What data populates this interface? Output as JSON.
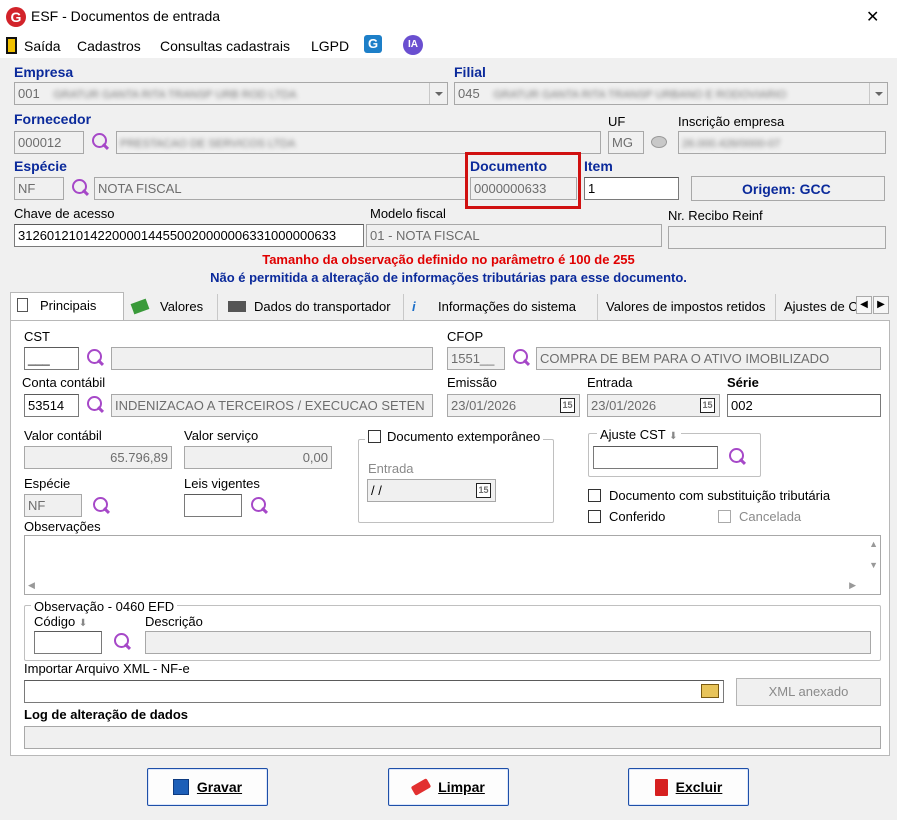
{
  "window": {
    "title": "ESF - Documentos de entrada",
    "close_glyph": "✕"
  },
  "menu": {
    "items": [
      "Saída",
      "Cadastros",
      "Consultas cadastrais",
      "LGPD"
    ],
    "ia_badge": "IA"
  },
  "header": {
    "empresa_label": "Empresa",
    "empresa_code": "001",
    "empresa_name": "GRATUR GANTA RITA TRANSP URB ROD LTDA",
    "filial_label": "Filial",
    "filial_code": "045",
    "filial_name": "GRATUR GANTA RITA TRANSP URBANO E RODOVIARIO",
    "fornecedor_label": "Fornecedor",
    "fornecedor_code": "000012",
    "fornecedor_name": "PRESTACAO DE SERVICOS LTDA",
    "uf_label": "UF",
    "uf_value": "MG",
    "inscricao_label": "Inscrição empresa",
    "inscricao_value": "26.000.426/0000-07",
    "especie_label": "Espécie",
    "especie_code": "NF",
    "especie_name": "NOTA FISCAL",
    "documento_label": "Documento",
    "documento_value": "0000000633",
    "item_label": "Item",
    "item_value": "1",
    "origem_text": "Origem: GCC",
    "chave_label": "Chave de acesso",
    "chave_value": "31260121014220000144550020000006331000000633",
    "modelo_label": "Modelo fiscal",
    "modelo_value": "01 - NOTA FISCAL",
    "recibo_label": "Nr. Recibo Reinf",
    "recibo_value": ""
  },
  "warnings": {
    "line1": "Tamanho da observação definido no parâmetro é 100 de 255",
    "line2": "Não é permitida a alteração de informações tributárias para esse documento."
  },
  "tabs": [
    "Principais",
    "Valores",
    "Dados do transportador",
    "Informações do sistema",
    "Valores de impostos retidos",
    "Ajustes de C"
  ],
  "principais": {
    "cst_label": "CST",
    "cst_value": "___",
    "cst_desc": "",
    "cfop_label": "CFOP",
    "cfop_value": "1551__",
    "cfop_desc": "COMPRA DE BEM PARA O ATIVO IMOBILIZADO",
    "conta_label": "Conta contábil",
    "conta_value": "53514",
    "conta_desc": "INDENIZACAO A TERCEIROS / EXECUCAO SETEN",
    "emissao_label": "Emissão",
    "emissao_value": "23/01/2026",
    "entrada_label": "Entrada",
    "entrada_value": "23/01/2026",
    "serie_label": "Série",
    "serie_value": "002",
    "valor_contabil_label": "Valor contábil",
    "valor_contabil_value": "65.796,89",
    "valor_servico_label": "Valor serviço",
    "valor_servico_value": "0,00",
    "doc_extemp_label": "Documento extemporâneo",
    "extemp_entrada_label": "Entrada",
    "extemp_entrada_value": "/ /",
    "ajuste_cst_label": "Ajuste CST",
    "especie_label": "Espécie",
    "especie_value": "NF",
    "leis_label": "Leis vigentes",
    "leis_value": "",
    "subst_label": "Documento com substituição tributária",
    "conferido_label": "Conferido",
    "cancelada_label": "Cancelada",
    "obs_label": "Observações",
    "obs_value": "",
    "obs0460_label": "Observação - 0460 EFD",
    "codigo_label": "Código",
    "descricao_label": "Descrição",
    "xml_label": "Importar Arquivo XML - NF-e",
    "xml_button": "XML anexado",
    "log_label": "Log de alteração de dados",
    "calendar_glyph": "15"
  },
  "buttons": {
    "gravar": "Gravar",
    "limpar": "Limpar",
    "excluir": "Excluir"
  },
  "colors": {
    "label_blue": "#0b2a9b",
    "warning_red": "#e00000",
    "highlight_red": "#d01010",
    "search_purple": "#a648c8"
  }
}
